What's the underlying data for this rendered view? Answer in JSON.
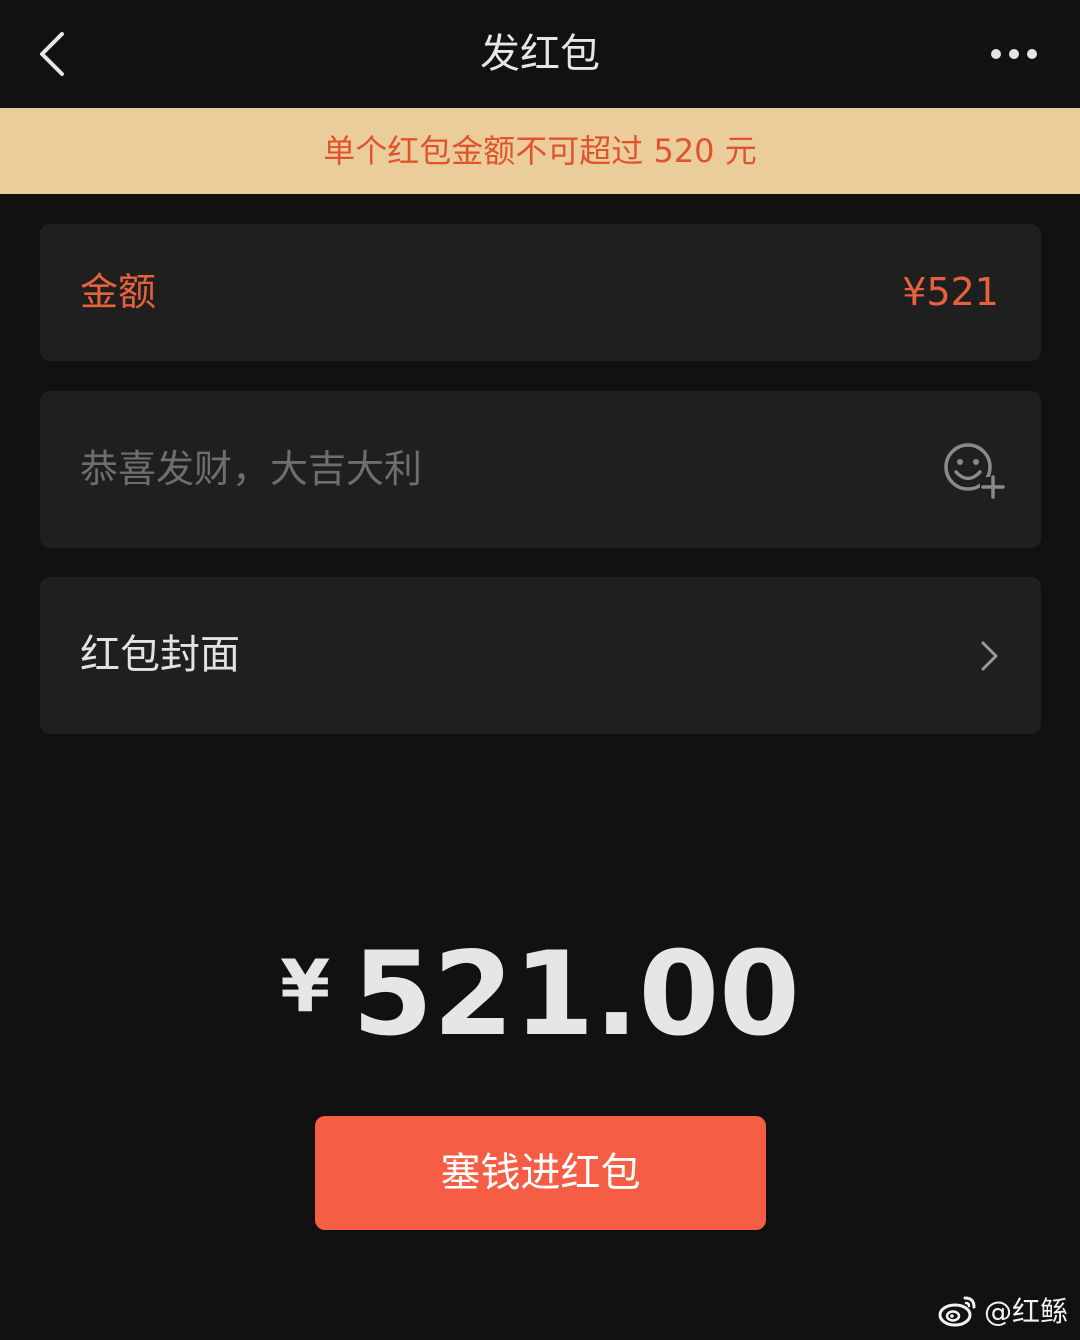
{
  "nav": {
    "title": "发红包",
    "back_icon": "chevron-left-icon",
    "more_icon": "more-horizontal-icon"
  },
  "notice": {
    "text": "单个红包金额不可超过 520 元"
  },
  "amount_card": {
    "label": "金额",
    "value": "¥521"
  },
  "greeting_card": {
    "placeholder": "恭喜发财，大吉大利",
    "value": "",
    "emoji_icon": "emoji-add-icon"
  },
  "cover_card": {
    "label": "红包封面",
    "chevron_icon": "chevron-right-icon"
  },
  "total": {
    "currency": "¥",
    "amount": "521.00"
  },
  "send_button": {
    "label": "塞钱进红包"
  },
  "watermark": {
    "text": "@红鲧"
  },
  "colors": {
    "background": "#111111",
    "card": "#1f1f1f",
    "notice_bg": "#ebcd9c",
    "accent": "#e8613d",
    "button": "#f55e45"
  }
}
